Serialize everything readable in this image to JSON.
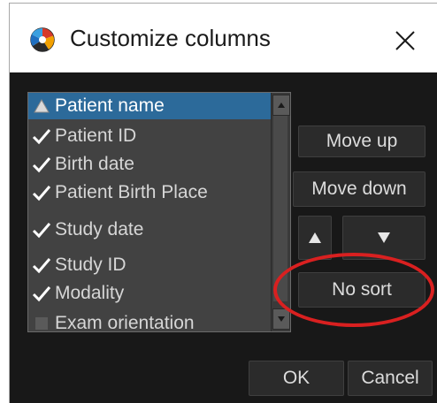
{
  "window": {
    "title": "Customize columns",
    "close_glyph": "×",
    "app_icon": "aperture-logo-icon"
  },
  "columns": [
    {
      "label": "Patient name",
      "mark": "sort-up",
      "selected": true
    },
    {
      "label": "Patient ID",
      "mark": "check",
      "selected": false
    },
    {
      "label": "Birth date",
      "mark": "check",
      "selected": false
    },
    {
      "label": "Patient Birth Place",
      "mark": "check",
      "selected": false
    },
    {
      "label": "Study date",
      "mark": "check",
      "selected": false
    },
    {
      "label": "Study ID",
      "mark": "check",
      "selected": false
    },
    {
      "label": "Modality",
      "mark": "check",
      "selected": false
    },
    {
      "label": "Exam orientation",
      "mark": "none",
      "selected": false
    }
  ],
  "buttons": {
    "move_up": "Move up",
    "move_down": "Move down",
    "sort_asc": "▲",
    "sort_desc": "▼",
    "no_sort": "No sort",
    "ok": "OK",
    "cancel": "Cancel"
  },
  "colors": {
    "client_bg": "#181818",
    "list_bg": "#424242",
    "selected_row": "#2c6a9a",
    "annotation_ring": "#d92020"
  }
}
